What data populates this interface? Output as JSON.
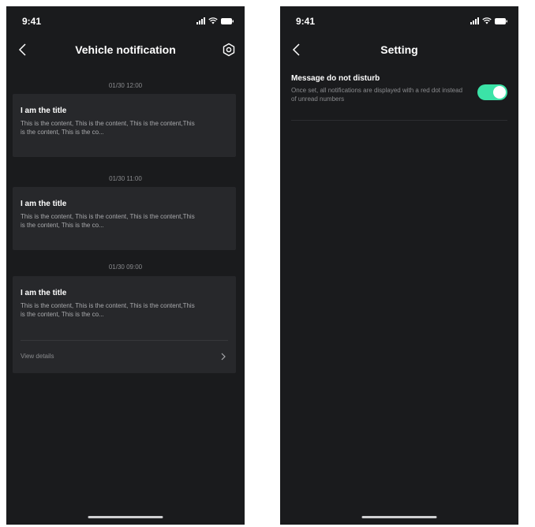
{
  "colors": {
    "screen_background": "#1a1b1d",
    "card_background": "#27282b",
    "toggle_on": "#3be3a7",
    "muted_text": "#8a8b8e"
  },
  "left_screen": {
    "status_bar": {
      "time": "9:41"
    },
    "nav": {
      "back_icon": "chevron-left-icon",
      "title": "Vehicle notification",
      "settings_icon": "gear-icon"
    },
    "notifications": [
      {
        "timestamp": "01/30 12:00",
        "title": "I am the title",
        "content": "This is the content, This is the content, This is the content,This is the content, This is the co..."
      },
      {
        "timestamp": "01/30 11:00",
        "title": "I am the title",
        "content": "This is the content, This is the content, This is the content,This is the content, This is the co..."
      },
      {
        "timestamp": "01/30 09:00",
        "title": "I am the title",
        "content": "This is the content, This is the content, This is the content,This is the content, This is the co...",
        "view_details_label": "View details"
      }
    ]
  },
  "right_screen": {
    "status_bar": {
      "time": "9:41"
    },
    "nav": {
      "back_icon": "chevron-left-icon",
      "title": "Setting"
    },
    "settings": [
      {
        "title": "Message do not disturb",
        "description": "Once set, all notifications are displayed with a red dot instead of unread numbers",
        "toggle_on": true
      }
    ]
  }
}
